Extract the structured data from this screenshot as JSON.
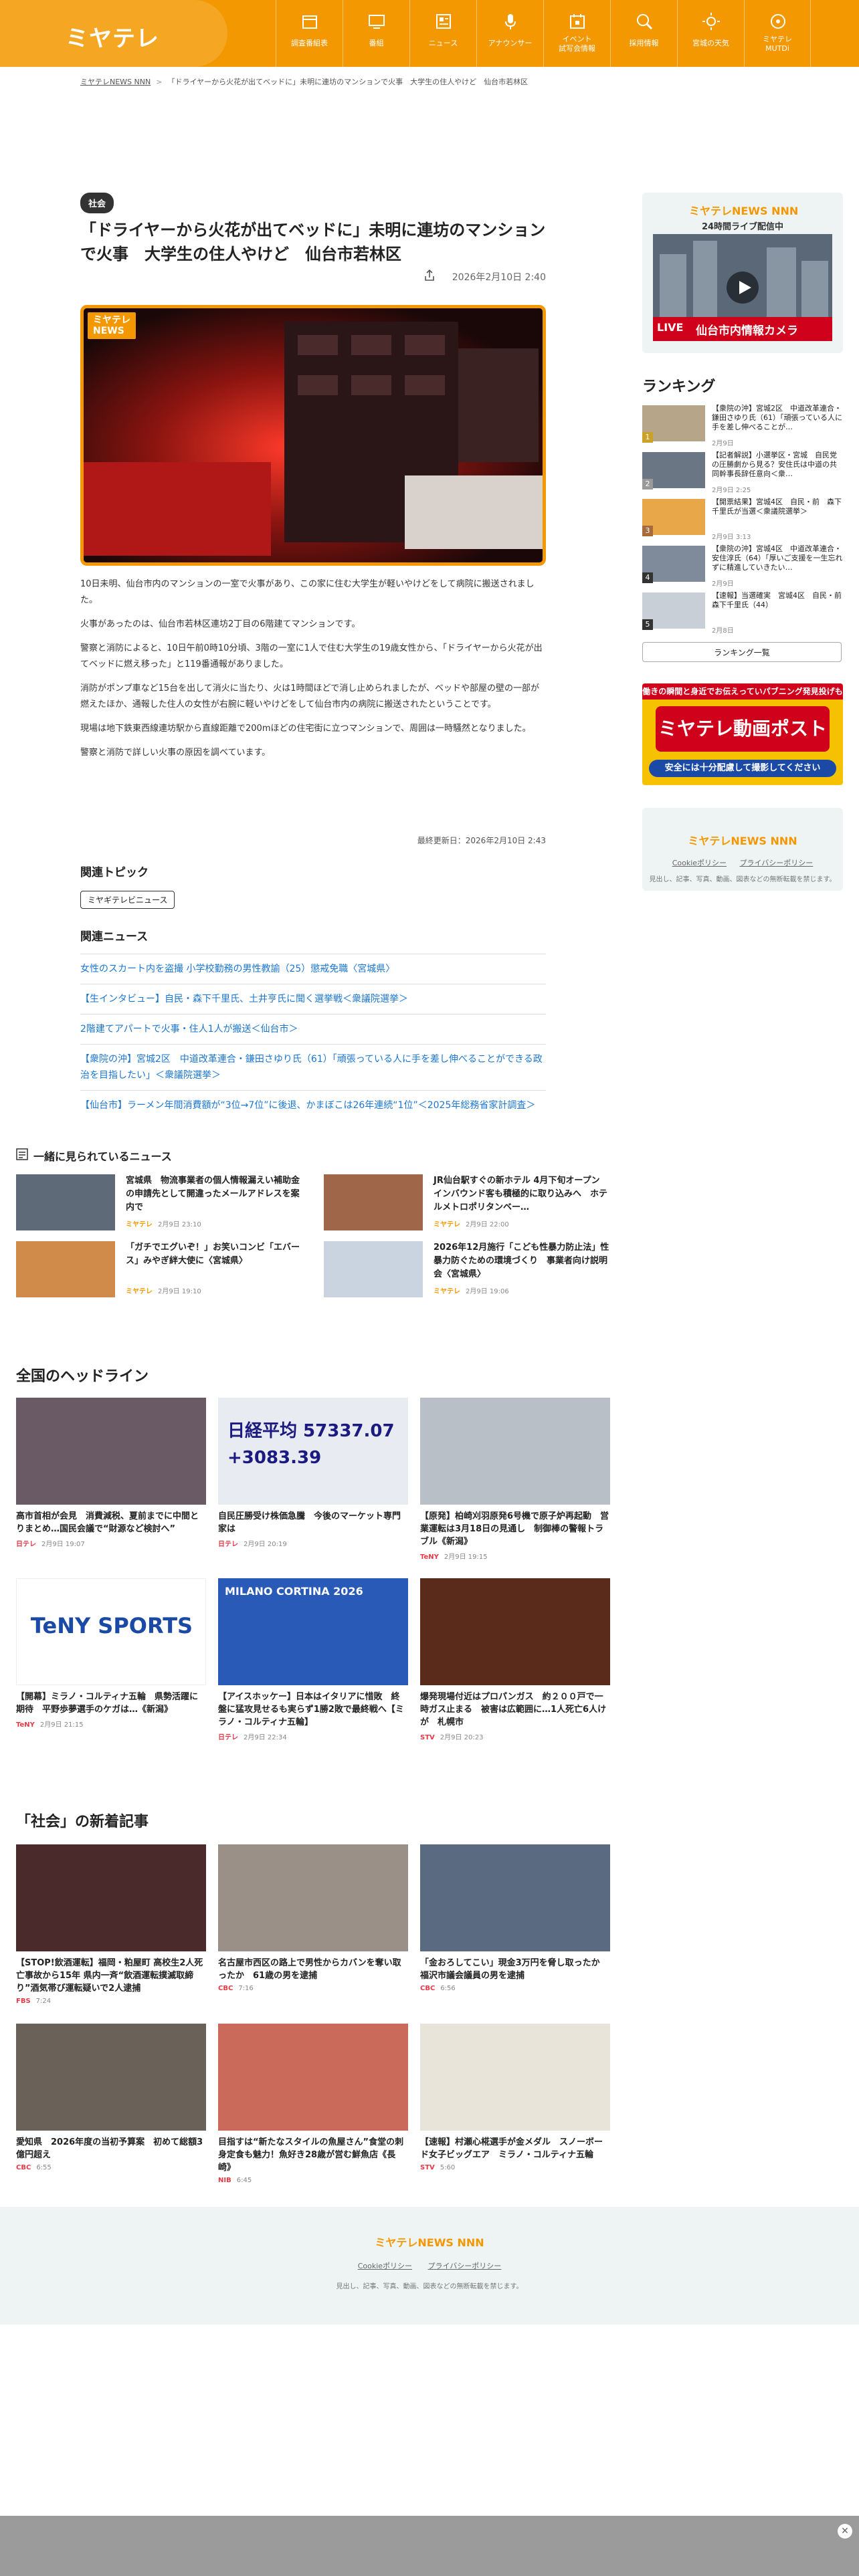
{
  "header": {
    "logo": "ミヤテレ",
    "nav": [
      {
        "label": "調査番組表"
      },
      {
        "label": "番組"
      },
      {
        "label": "ニュース"
      },
      {
        "label": "アナウンサー"
      },
      {
        "label": "イベント\n試写会情報"
      },
      {
        "label": "採用情報"
      },
      {
        "label": "宮城の天気"
      },
      {
        "label": "ミヤテレ\nMUTDi"
      }
    ]
  },
  "breadcrumb": {
    "home": "ミヤテレNEWS NNN",
    "current": "「ドライヤーから火花が出てベッドに」未明に連坊のマンションで火事　大学生の住人やけど　仙台市若林区"
  },
  "article": {
    "category": "社会",
    "title": "「ドライヤーから火花が出てベッドに」未明に連坊のマンションで火事　大学生の住人やけど　仙台市若林区",
    "date": "2026年2月10日 2:40",
    "hero_badge": "ミヤテレ\nNEWS",
    "paragraphs": [
      "10日未明、仙台市内のマンションの一室で火事があり、この家に住む大学生が軽いやけどをして病院に搬送されました。",
      "火事があったのは、仙台市若林区連坊2丁目の6階建てマンションです。",
      "警察と消防によると、10日午前0時10分頃、3階の一室に1人で住む大学生の19歳女性から、「ドライヤーから火花が出てベッドに燃え移った」と119番通報がありました。",
      "消防がポンプ車など15台を出して消火に当たり、火は1時間ほどで消し止められましたが、ベッドや部屋の壁の一部が燃えたほか、通報した住人の女性が右腕に軽いやけどをして仙台市内の病院に搬送されたということです。",
      "現場は地下鉄東西線連坊駅から直線距離で200mほどの住宅街に立つマンションで、周囲は一時騒然となりました。",
      "警察と消防で詳しい火事の原因を調べています。"
    ],
    "updated": "最終更新日：2026年2月10日 2:43"
  },
  "topics": {
    "heading": "関連トピック",
    "tag": "ミヤギテレビニュース"
  },
  "related": {
    "heading": "関連ニュース",
    "items": [
      "女性のスカート内を盗撮 小学校勤務の男性教諭（25）懲戒免職〈宮城県〉",
      "【生インタビュー】自民・森下千里氏、土井亨氏に聞く選挙戦＜衆議院選挙＞",
      "2階建てアパートで火事・住人1人が搬送＜仙台市＞",
      "【衆院の沖】宮城2区　中道改革連合・鎌田さゆり氏（61）「頑張っている人に手を差し伸べることができる政治を目指したい」＜衆議院選挙＞",
      "【仙台市】ラーメン年間消費額が“3位→7位”に後退、かまぼこは26年連続“1位”＜2025年総務省家計調査＞"
    ]
  },
  "live": {
    "brand": "ミヤテレNEWS NNN",
    "subtitle": "24時間ライブ配信中",
    "live_tag": "LIVE",
    "camera": "仙台市内情報カメラ"
  },
  "ranking": {
    "heading": "ランキング",
    "items": [
      {
        "num": "1",
        "title": "【衆院の沖】宮城2区　中道改革連合・鎌田さゆり氏（61）「頑張っている人に手を差し伸べることが…",
        "date": "2月9日"
      },
      {
        "num": "2",
        "title": "【記者解説】小選挙区・宮城　自民党の圧勝劇から見る？安住氏は中道の共同幹事長辞任意向＜衆…",
        "date": "2月9日 2:25"
      },
      {
        "num": "3",
        "title": "【開票結果】宮城4区　自民・前　森下千里氏が当選＜衆議院選挙＞",
        "date": "2月9日 3:13"
      },
      {
        "num": "4",
        "title": "【衆院の沖】宮城4区　中道改革連合・安住淳氏（64）「厚いご支援を一生忘れずに精進していきたい…",
        "date": "2月9日"
      },
      {
        "num": "5",
        "title": "【速報】当選確実　宮城4区　自民・前　森下千里氏（44）",
        "date": "2月8日"
      }
    ],
    "more": "ランキング一覧"
  },
  "banner": {
    "top": "働きの瞬間と身近でお伝えっていパブニング発見投げも",
    "main": "ミヤテレ動画ポスト",
    "bottom": "安全には十分配慮して撮影してください"
  },
  "brand_card": {
    "logo": "ミヤテレNEWS NNN",
    "links": [
      "Cookieポリシー",
      "プライバシーポリシー"
    ],
    "note": "見出し、記事、写真、動画、図表などの無断転載を禁じます。"
  },
  "together": {
    "heading": "一緒に見られているニュース",
    "items": [
      {
        "title": "宮城県　物流事業者の個人情報漏えい補助金の申請先として開違ったメールアドレスを案内で",
        "src": "ミヤテレ",
        "date": "2月9日 23:10"
      },
      {
        "title": "JR仙台駅すぐの新ホテル 4月下旬オープン　インバウンド客も積極的に取り込みへ　ホテルメトロポリタンベー…",
        "src": "ミヤテレ",
        "date": "2月9日 22:00"
      },
      {
        "title": "「ガチでエグいぞ！」お笑いコンビ「エバース」みやぎ絆大使に〈宮城県〉",
        "src": "ミヤテレ",
        "date": "2月9日 19:10"
      },
      {
        "title": "2026年12月施行「こども性暴力防止法」性暴力防ぐための環境づくり　事業者向け説明会〈宮城県〉",
        "src": "ミヤテレ",
        "date": "2月9日 19:06"
      }
    ]
  },
  "national": {
    "heading": "全国のヘッドライン",
    "items": [
      {
        "title": "高市首相が会見　消費減税、夏前までに中間とりまとめ…国民会議で“財源など検討へ”",
        "src": "日テレ",
        "date": "2月9日 19:07",
        "thumb_text": ""
      },
      {
        "title": "自民圧勝受け株価急騰　今後のマーケット専門家は",
        "src": "日テレ",
        "date": "2月9日 20:19",
        "thumb_text": "日経平均 57337.07 +3083.39"
      },
      {
        "title": "【原発】柏崎刈羽原発6号機で原子炉再起動　営業運転は3月18日の見通し　制御棒の警報トラブル《新潟》",
        "src": "TeNY",
        "date": "2月9日 19:15",
        "thumb_text": ""
      },
      {
        "title": "【開幕】ミラノ・コルティナ五輪　県勢活躍に期待　平野歩夢選手のケガは…《新潟》",
        "src": "TeNY",
        "date": "2月9日 21:15",
        "thumb_text": "TeNY SPORTS"
      },
      {
        "title": "【アイスホッケー】日本はイタリアに惜敗　終盤に猛攻見せるも実らず1勝2敗で最終戦へ【ミラノ・コルティナ五輪】",
        "src": "日テレ",
        "date": "2月9日 22:34",
        "thumb_text": "MILANO CORTINA 2026"
      },
      {
        "title": "爆発現場付近はプロパンガス　約２００戸で一時ガス止まる　被害は広範囲に…1人死亡6人けが　札幌市",
        "src": "STV",
        "date": "2月9日 20:23",
        "thumb_text": ""
      }
    ]
  },
  "social": {
    "heading": "「社会」の新着記事",
    "items": [
      {
        "title": "【STOP!飲酒運転】福岡・粕屋町 高校生2人死亡事故から15年 県内一斉“飲酒運転撲滅取締り”酒気帯び運転疑いで2人逮捕",
        "src": "FBS",
        "date": "7:24"
      },
      {
        "title": "名古屋市西区の路上で男性からカバンを奪い取ったか　61歳の男を逮捕",
        "src": "CBC",
        "date": "7:16"
      },
      {
        "title": "「金おろしてこい」現金3万円を脅し取ったか　福沢市議会議員の男を逮捕",
        "src": "CBC",
        "date": "6:56"
      },
      {
        "title": "愛知県　2026年度の当初予算案　初めて総額3億円超え",
        "src": "CBC",
        "date": "6:55"
      },
      {
        "title": "目指すは“新たなスタイルの魚屋さん”食堂の刺身定食も魅力！魚好き28歳が営む鮮魚店《長崎》",
        "src": "NIB",
        "date": "6:45"
      },
      {
        "title": "【速報】村瀬心椛選手が金メダル　スノーボード女子ビッグエア　ミラノ・コルティナ五輪",
        "src": "STV",
        "date": "5:60"
      }
    ]
  },
  "footer": {
    "logo": "ミヤテレNEWS NNN",
    "links": [
      "Cookieポリシー",
      "プライバシーポリシー"
    ],
    "note": "見出し、記事、写真、動画、図表などの無断転載を禁じます。"
  },
  "colors": {
    "brand": "#f39800",
    "accent_link": "#1a76d2",
    "live_red": "#d0021b"
  }
}
